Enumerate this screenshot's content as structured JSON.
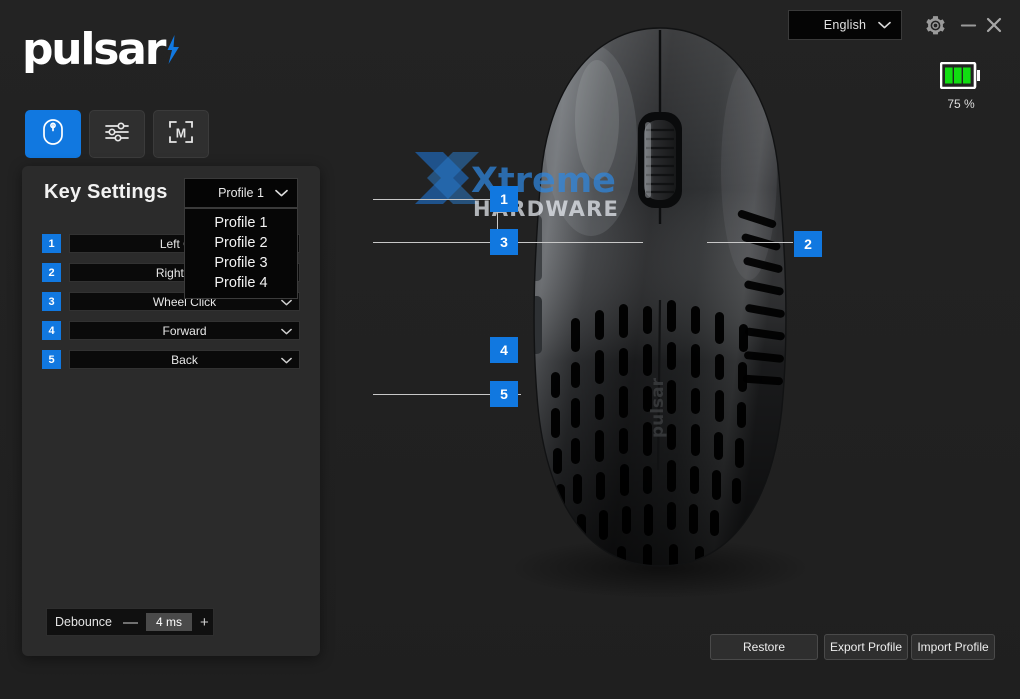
{
  "app": {
    "brand": "pulsar",
    "brand_icon": "lightning-bolt-icon"
  },
  "header": {
    "language": {
      "value": "English",
      "chevron_icon": "chevron-down-icon"
    },
    "gear_icon": "gear-icon",
    "minimize_icon": "minimize-icon",
    "close_icon": "close-icon"
  },
  "battery": {
    "icon": "battery-icon",
    "percent_label": "75 %",
    "level": 75,
    "color": "#1ddd1d"
  },
  "tabs": [
    {
      "id": "mouse",
      "icon": "mouse-icon",
      "active": true
    },
    {
      "id": "performance",
      "icon": "sliders-icon",
      "active": false
    },
    {
      "id": "macro",
      "icon": "macro-m-icon",
      "active": false
    }
  ],
  "panel": {
    "title": "Key Settings",
    "profile_select": {
      "value": "Profile 1",
      "chevron_icon": "chevron-down-icon",
      "expanded": true,
      "options": [
        "Profile 1",
        "Profile 2",
        "Profile 3",
        "Profile 4"
      ]
    },
    "keys": [
      {
        "num": "1",
        "value": "Left Click",
        "chevron_icon": "chevron-down-icon"
      },
      {
        "num": "2",
        "value": "Right Click",
        "chevron_icon": "chevron-down-icon"
      },
      {
        "num": "3",
        "value": "Wheel Click",
        "chevron_icon": "chevron-down-icon"
      },
      {
        "num": "4",
        "value": "Forward",
        "chevron_icon": "chevron-down-icon"
      },
      {
        "num": "5",
        "value": "Back",
        "chevron_icon": "chevron-down-icon"
      }
    ],
    "debounce": {
      "label": "Debounce",
      "decrement": "—",
      "value": "4 ms",
      "increment": "+"
    }
  },
  "stage": {
    "device_image": "gaming-mouse-top-view",
    "callouts": [
      "1",
      "2",
      "3",
      "4",
      "5"
    ],
    "watermark": {
      "line1": "Xtreme",
      "line2": "HARDWARE"
    }
  },
  "footer": {
    "restore": "Restore",
    "export": "Export Profile",
    "import": "Import Profile"
  },
  "colors": {
    "accent": "#1178e0",
    "background": "#222222",
    "panel": "#2b2b2b",
    "field": "#0a0a0a"
  }
}
